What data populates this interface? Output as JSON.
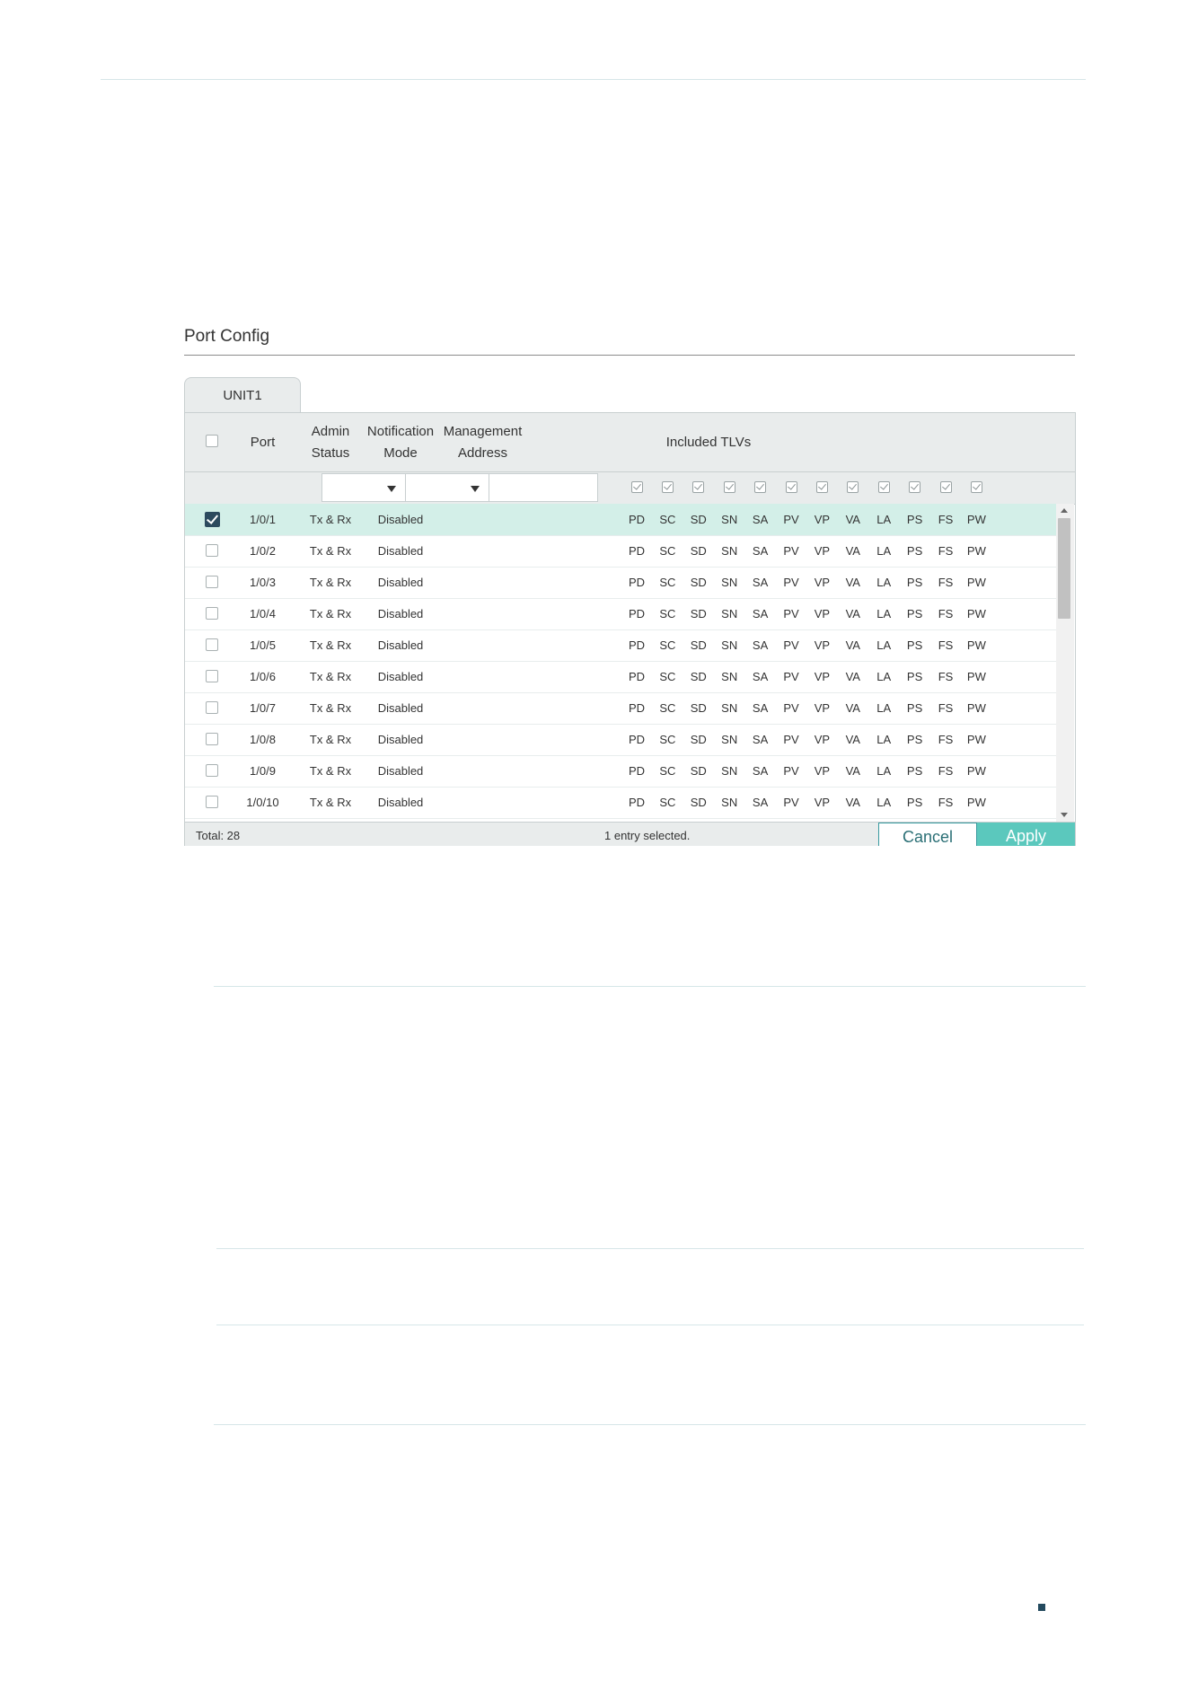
{
  "section": {
    "title": "Port Config"
  },
  "tab": {
    "label": "UNIT1"
  },
  "headers": {
    "port": "Port",
    "admin_status": "Admin\nStatus",
    "notification_mode": "Notification\nMode",
    "management_address": "Management\nAddress",
    "included_tlvs": "Included TLVs"
  },
  "tlvs": [
    "PD",
    "SC",
    "SD",
    "SN",
    "SA",
    "PV",
    "VP",
    "VA",
    "LA",
    "PS",
    "FS",
    "PW"
  ],
  "rows": [
    {
      "port": "1/0/1",
      "admin": "Tx & Rx",
      "notify": "Disabled",
      "mgmt": "",
      "selected": true
    },
    {
      "port": "1/0/2",
      "admin": "Tx & Rx",
      "notify": "Disabled",
      "mgmt": "",
      "selected": false
    },
    {
      "port": "1/0/3",
      "admin": "Tx & Rx",
      "notify": "Disabled",
      "mgmt": "",
      "selected": false
    },
    {
      "port": "1/0/4",
      "admin": "Tx & Rx",
      "notify": "Disabled",
      "mgmt": "",
      "selected": false
    },
    {
      "port": "1/0/5",
      "admin": "Tx & Rx",
      "notify": "Disabled",
      "mgmt": "",
      "selected": false
    },
    {
      "port": "1/0/6",
      "admin": "Tx & Rx",
      "notify": "Disabled",
      "mgmt": "",
      "selected": false
    },
    {
      "port": "1/0/7",
      "admin": "Tx & Rx",
      "notify": "Disabled",
      "mgmt": "",
      "selected": false
    },
    {
      "port": "1/0/8",
      "admin": "Tx & Rx",
      "notify": "Disabled",
      "mgmt": "",
      "selected": false
    },
    {
      "port": "1/0/9",
      "admin": "Tx & Rx",
      "notify": "Disabled",
      "mgmt": "",
      "selected": false
    },
    {
      "port": "1/0/10",
      "admin": "Tx & Rx",
      "notify": "Disabled",
      "mgmt": "",
      "selected": false
    }
  ],
  "footer": {
    "total": "Total: 28",
    "selection": "1 entry selected.",
    "cancel": "Cancel",
    "apply": "Apply"
  },
  "colors": {
    "accent": "#5bc8bd",
    "selected_row": "#d3efe8",
    "checkbox_checked": "#2c4a5e"
  }
}
